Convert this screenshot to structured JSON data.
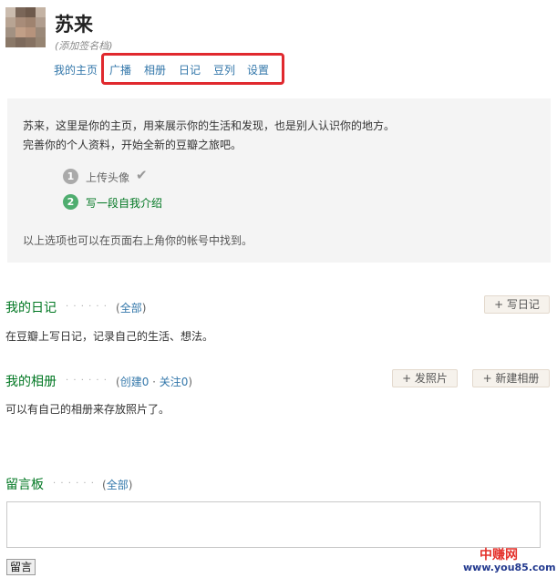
{
  "profile": {
    "name": "苏来",
    "signature": "(添加签名档)"
  },
  "nav": {
    "items": [
      {
        "label": "我的主页"
      },
      {
        "label": "广播"
      },
      {
        "label": "相册"
      },
      {
        "label": "日记"
      },
      {
        "label": "豆列"
      },
      {
        "label": "设置"
      }
    ]
  },
  "intro": {
    "line1": "苏来，这里是你的主页，用来展示你的生活和发现，也是别人认识你的地方。",
    "line2": "完善你的个人资料，开始全新的豆瓣之旅吧。",
    "steps": [
      {
        "num": "1",
        "label": "上传头像",
        "state": "done",
        "color": "#aaaaaa"
      },
      {
        "num": "2",
        "label": "写一段自我介绍",
        "state": "todo",
        "color": "#4fad6f"
      }
    ],
    "hint": "以上选项也可以在页面右上角你的帐号中找到。"
  },
  "diary": {
    "title": "我的日记",
    "dots": "· · · · · ·",
    "link_open": "(",
    "link": "全部",
    "link_close": ")",
    "desc": "在豆瓣上写日记，记录自己的生活、想法。",
    "button": "+ 写日记"
  },
  "album": {
    "title": "我的相册",
    "dots": "· · · · · ·",
    "link_open": "(",
    "link_created": "创建0",
    "link_sep": " · ",
    "link_follow": "关注0",
    "link_close": ")",
    "desc": "可以有自己的相册来存放照片了。",
    "button_upload": "+ 发照片",
    "button_new": "+ 新建相册"
  },
  "board": {
    "title": "留言板",
    "dots": "· · · · · ·",
    "link_open": "(",
    "link": "全部",
    "link_close": ")",
    "input_value": "",
    "submit": "留言"
  },
  "watermark": {
    "line1": "中赚网",
    "line2": "www.you85.com"
  },
  "colors": {
    "link": "#3377aa",
    "section_title": "#007722",
    "highlight": "#e0292e"
  }
}
